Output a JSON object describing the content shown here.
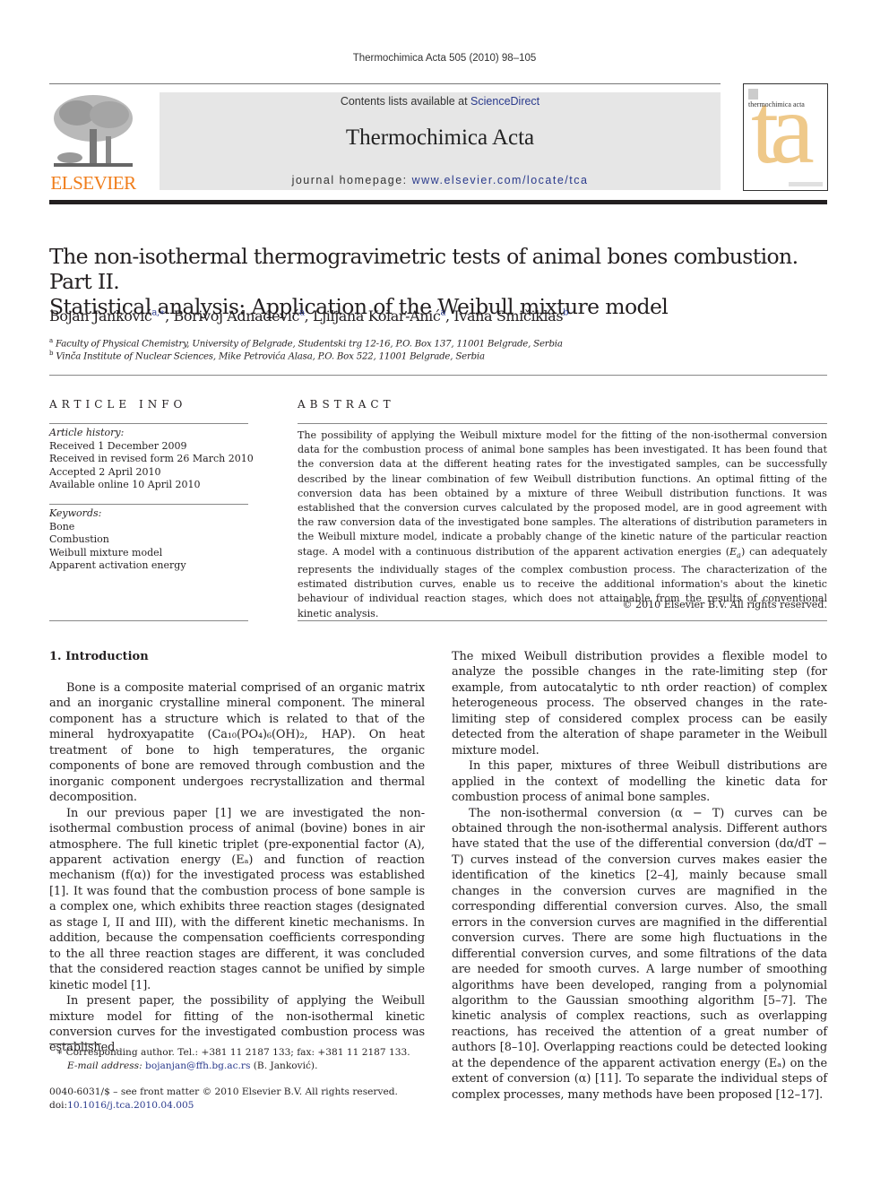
{
  "running_header": "Thermochimica Acta 505 (2010) 98–105",
  "publisher": {
    "name": "ELSEVIER",
    "brand_color": "#f07d1a"
  },
  "banner": {
    "contents_prefix": "Contents lists available at ",
    "contents_link": "ScienceDirect",
    "journal_title": "Thermochimica Acta",
    "homepage_prefix": "journal homepage: ",
    "homepage_url": "www.elsevier.com/locate/tca",
    "background": "#e6e6e6"
  },
  "cover": {
    "title": "thermochimica acta",
    "monogram": "ta",
    "accent": "#efc98a"
  },
  "article": {
    "title_line1": "The non-isothermal thermogravimetric tests of animal bones combustion. Part II.",
    "title_line2": "Statistical analysis: Application of the Weibull mixture model",
    "authors": [
      {
        "name": "Bojan Janković",
        "sup": "a,∗"
      },
      {
        "name": "Borivoj Adnađević",
        "sup": "a"
      },
      {
        "name": "Ljiljana Kolar-Anić",
        "sup": "a"
      },
      {
        "name": "Ivana Smičiklas",
        "sup": "b"
      }
    ],
    "affiliations": [
      {
        "mark": "a",
        "text": "Faculty of Physical Chemistry, University of Belgrade, Studentski trg 12-16, P.O. Box 137, 11001 Belgrade, Serbia"
      },
      {
        "mark": "b",
        "text": "Vinča Institute of Nuclear Sciences, Mike Petrovića Alasa, P.O. Box 522, 11001 Belgrade, Serbia"
      }
    ]
  },
  "article_info": {
    "heading": "ARTICLE INFO",
    "history_label": "Article history:",
    "history": [
      "Received 1 December 2009",
      "Received in revised form 26 March 2010",
      "Accepted 2 April 2010",
      "Available online 10 April 2010"
    ],
    "keywords_label": "Keywords:",
    "keywords": [
      "Bone",
      "Combustion",
      "Weibull mixture model",
      "Apparent activation energy"
    ]
  },
  "abstract": {
    "heading": "ABSTRACT",
    "text_part1": "The possibility of applying the Weibull mixture model for the fitting of the non-isothermal conversion data for the combustion process of animal bone samples has been investigated. It has been found that the conversion data at the different heating rates for the investigated samples, can be successfully described by the linear combination of few Weibull distribution functions. An optimal fitting of the conversion data has been obtained by a mixture of three Weibull distribution functions. It was established that the conversion curves calculated by the proposed model, are in good agreement with the raw conversion data of the investigated bone samples. The alterations of distribution parameters in the Weibull mixture model, indicate a probably change of the kinetic nature of the particular reaction stage. A model with a continuous distribution of the apparent activation energies (",
    "symbol_Ea": "E",
    "symbol_Ea_sub": "a",
    "text_part2": ") can adequately represents the individually stages of the complex combustion process. The characterization of the estimated distribution curves, enable us to receive the additional information's about the kinetic behaviour of individual reaction stages, which does not attainable from the results of conventional kinetic analysis.",
    "copyright": "© 2010 Elsevier B.V. All rights reserved."
  },
  "introduction": {
    "heading": "1.  Introduction",
    "left_paragraphs": [
      "Bone is a composite material comprised of an organic matrix and an inorganic crystalline mineral component. The mineral component has a structure which is related to that of the mineral hydroxyapatite (Ca₁₀(PO₄)₆(OH)₂, HAP). On heat treatment of bone to high temperatures, the organic components of bone are removed through combustion and the inorganic component undergoes recrystallization and thermal decomposition.",
      "In our previous paper [1] we are investigated the non-isothermal combustion process of animal (bovine) bones in air atmosphere. The full kinetic triplet (pre-exponential factor (A), apparent activation energy (Eₐ) and function of reaction mechanism (f(α)) for the investigated process was established [1]. It was found that the combustion process of bone sample is a complex one, which exhibits three reaction stages (designated as stage I, II and III), with the different kinetic mechanisms. In addition, because the compensation coefficients corresponding to the all three reaction stages are different, it was concluded that the considered reaction stages cannot be unified by simple kinetic model [1].",
      "In present paper, the possibility of applying the Weibull mixture model for fitting of the non-isothermal kinetic conversion curves for the investigated combustion process was established."
    ],
    "right_paragraphs": [
      "The mixed Weibull distribution provides a flexible model to analyze the possible changes in the rate-limiting step (for example, from autocatalytic to nth order reaction) of complex heterogeneous process. The observed changes in the rate-limiting step of considered complex process can be easily detected from the alteration of shape parameter in the Weibull mixture model.",
      "In this paper, mixtures of three Weibull distributions are applied in the context of modelling the kinetic data for combustion process of animal bone samples.",
      "The non-isothermal conversion (α − T) curves can be obtained through the non-isothermal analysis. Different authors have stated that the use of the differential conversion (dα/dT − T) curves instead of the conversion curves makes easier the identification of the kinetics [2–4], mainly because small changes in the conversion curves are magnified in the corresponding differential conversion curves. Also, the small errors in the conversion curves are magnified in the differential conversion curves. There are some high fluctuations in the differential conversion curves, and some filtrations of the data are needed for smooth curves. A large number of smoothing algorithms have been developed, ranging from a polynomial algorithm to the Gaussian smoothing algorithm [5–7]. The kinetic analysis of complex reactions, such as overlapping reactions, has received the attention of a great number of authors [8–10]. Overlapping reactions could be detected looking at the dependence of the apparent activation energy (Eₐ) on the extent of conversion (α) [11]. To separate the individual steps of complex processes, many methods have been proposed [12–17]."
    ]
  },
  "footnotes": {
    "corresponding": "∗  Corresponding author. Tel.: +381 11 2187 133; fax: +381 11 2187 133.",
    "email_label": "E-mail address: ",
    "email": "bojanjan@ffh.bg.ac.rs",
    "email_suffix": " (B. Janković).",
    "front_matter": "0040-6031/$ – see front matter © 2010 Elsevier B.V. All rights reserved.",
    "doi_label": "doi:",
    "doi": "10.1016/j.tca.2010.04.005"
  },
  "colors": {
    "link": "#2a3a8c",
    "text": "#231f20"
  }
}
